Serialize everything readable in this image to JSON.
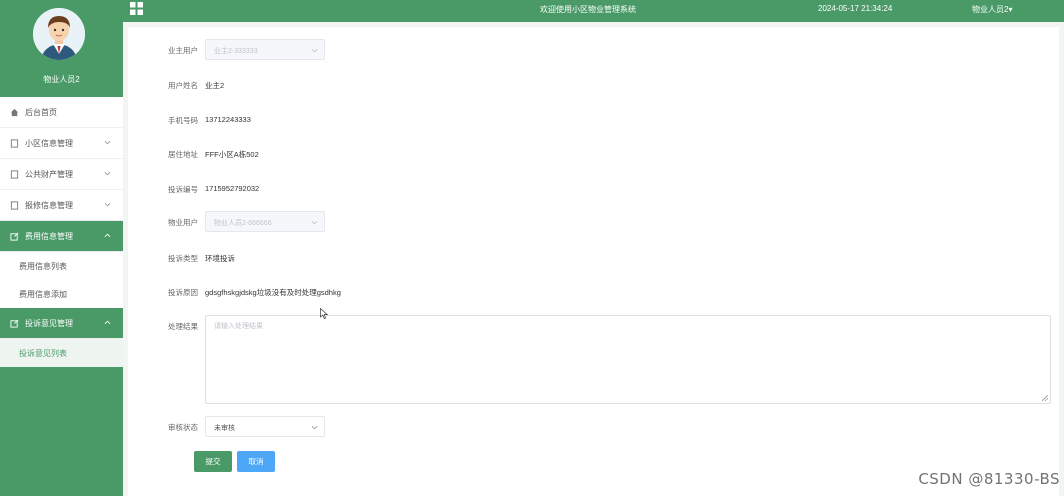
{
  "sidebar": {
    "user_name": "物业人员2",
    "menu": [
      {
        "label": "后台首页",
        "icon": "home-icon"
      },
      {
        "label": "小区信息管理",
        "icon": "document-icon"
      },
      {
        "label": "公共财产管理",
        "icon": "document-icon"
      },
      {
        "label": "报修信息管理",
        "icon": "document-icon"
      },
      {
        "label": "费用信息管理",
        "icon": "edit-icon"
      },
      {
        "label": "投诉意见管理",
        "icon": "edit-icon"
      }
    ],
    "fee_subitems": [
      "费用信息列表",
      "费用信息添加"
    ],
    "complaint_subitems": [
      "投诉意见列表"
    ]
  },
  "header": {
    "welcome": "欢迎使用小区物业管理系统",
    "datetime": "2024-05-17 21:34:24",
    "user_menu": "物业人员2▾"
  },
  "form": {
    "owner_user": {
      "label": "业主用户",
      "value": "业主2-333333"
    },
    "user_name": {
      "label": "用户姓名",
      "value": "业主2"
    },
    "phone": {
      "label": "手机号码",
      "value": "13712243333"
    },
    "address": {
      "label": "居住地址",
      "value": "FFF小区A栋502"
    },
    "complaint_no": {
      "label": "投诉编号",
      "value": "1715952792032"
    },
    "property_user": {
      "label": "物业用户",
      "value": "物业人员2-666666"
    },
    "complaint_type": {
      "label": "投诉类型",
      "value": "环境投诉"
    },
    "complaint_reason": {
      "label": "投诉原因",
      "value": "gdsgfhskgjdskg垃圾没有及时处理gsdhkg"
    },
    "result": {
      "label": "处理结果",
      "placeholder": "请输入处理结果"
    },
    "review_status": {
      "label": "审核状态",
      "value": "未审核"
    },
    "submit_label": "提交",
    "cancel_label": "取消"
  },
  "watermark": "CSDN @81330-BS",
  "colors": {
    "primary": "#4a9a68",
    "cancel": "#4ea6f7"
  }
}
